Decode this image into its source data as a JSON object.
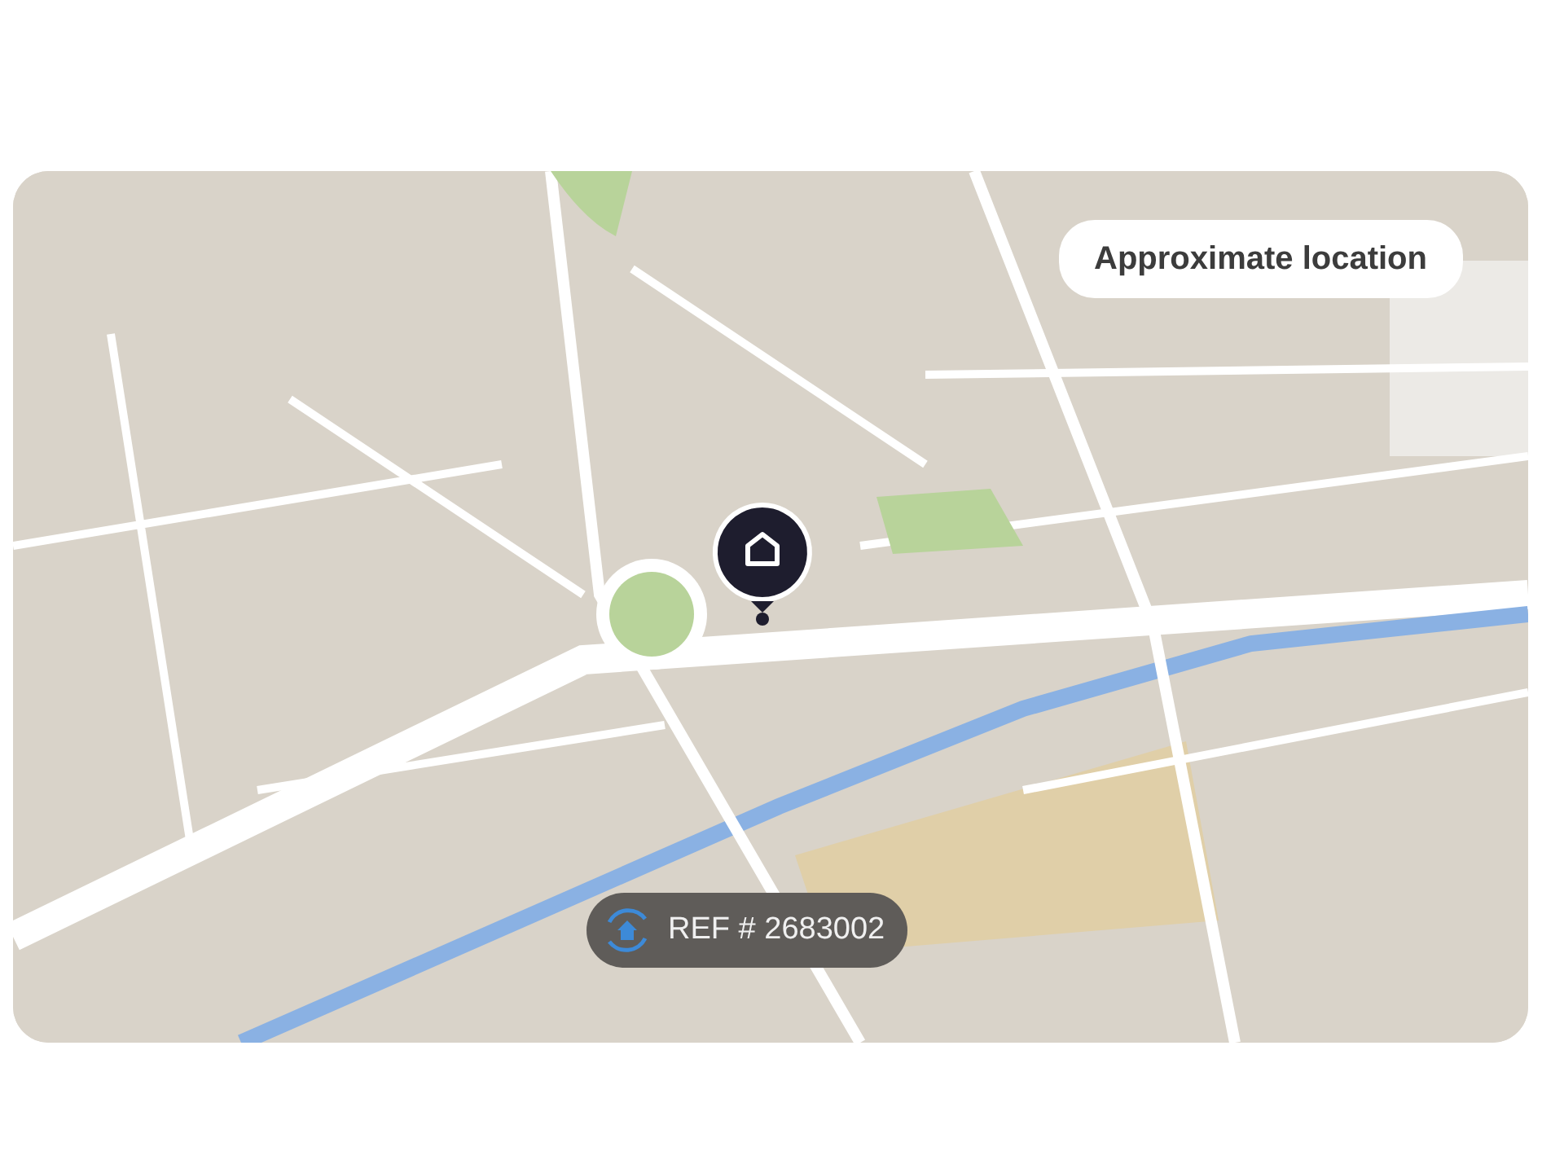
{
  "map": {
    "badge": "Approximate location",
    "reference": "REF # 2683002"
  }
}
